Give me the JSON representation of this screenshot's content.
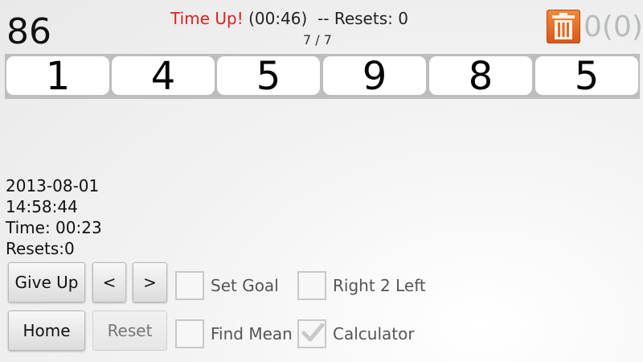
{
  "target_number": "86",
  "status": {
    "time_up": "Time Up!",
    "rest": " (00:46)  -- Resets: 0"
  },
  "progress": "7 / 7",
  "trash": {
    "icon": "trash-icon",
    "count": "0(0)",
    "color": "#e86f2a"
  },
  "cards": [
    "1",
    "4",
    "5",
    "9",
    "8",
    "5"
  ],
  "info": {
    "date": "2013-08-01",
    "time": "14:58:44",
    "elapsed": "Time: 00:23",
    "resets": "Resets:0"
  },
  "buttons": {
    "give_up": "Give Up",
    "prev": "<",
    "next": ">",
    "home": "Home",
    "reset": "Reset"
  },
  "options": [
    {
      "label": "Set Goal",
      "checked": false
    },
    {
      "label": "Right 2 Left",
      "checked": false
    },
    {
      "label": "Find Mean",
      "checked": false
    },
    {
      "label": "Calculator",
      "checked": true
    }
  ]
}
